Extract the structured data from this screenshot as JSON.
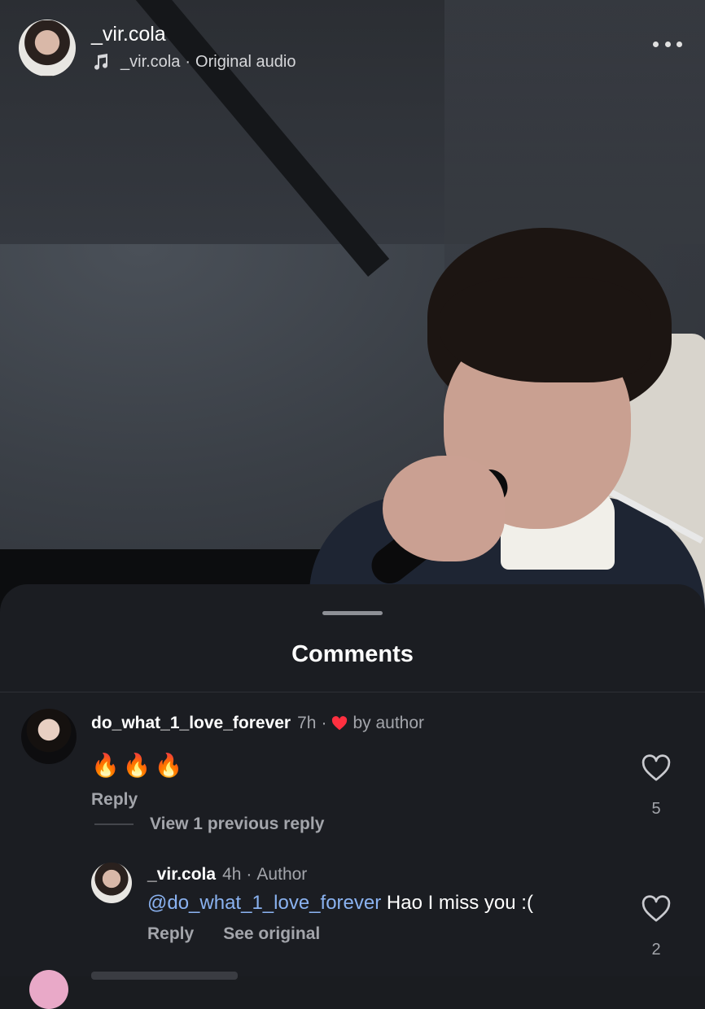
{
  "header": {
    "username": "_vir.cola",
    "audio_owner": "_vir.cola",
    "audio_separator": "·",
    "audio_title": "Original audio"
  },
  "sheet": {
    "title": "Comments"
  },
  "comments": [
    {
      "username": "do_what_1_love_forever",
      "time": "7h",
      "separator": "·",
      "liked_by": "by author",
      "text": "🔥🔥🔥",
      "reply_label": "Reply",
      "like_count": "5"
    }
  ],
  "view_replies_label": "View 1 previous reply",
  "replies": [
    {
      "username": "_vir.cola",
      "time": "4h",
      "separator": "·",
      "badge": "Author",
      "mention": "@do_what_1_love_forever",
      "text": " Hao I miss you :(",
      "reply_label": "Reply",
      "see_original_label": "See original",
      "like_count": "2"
    }
  ],
  "colors": {
    "background": "#1b1d22",
    "mention": "#8ab2f0",
    "like_heart": "#ff3040"
  },
  "icons": [
    "music-note-icon",
    "more-icon",
    "heart-icon",
    "heart-outline-icon"
  ]
}
